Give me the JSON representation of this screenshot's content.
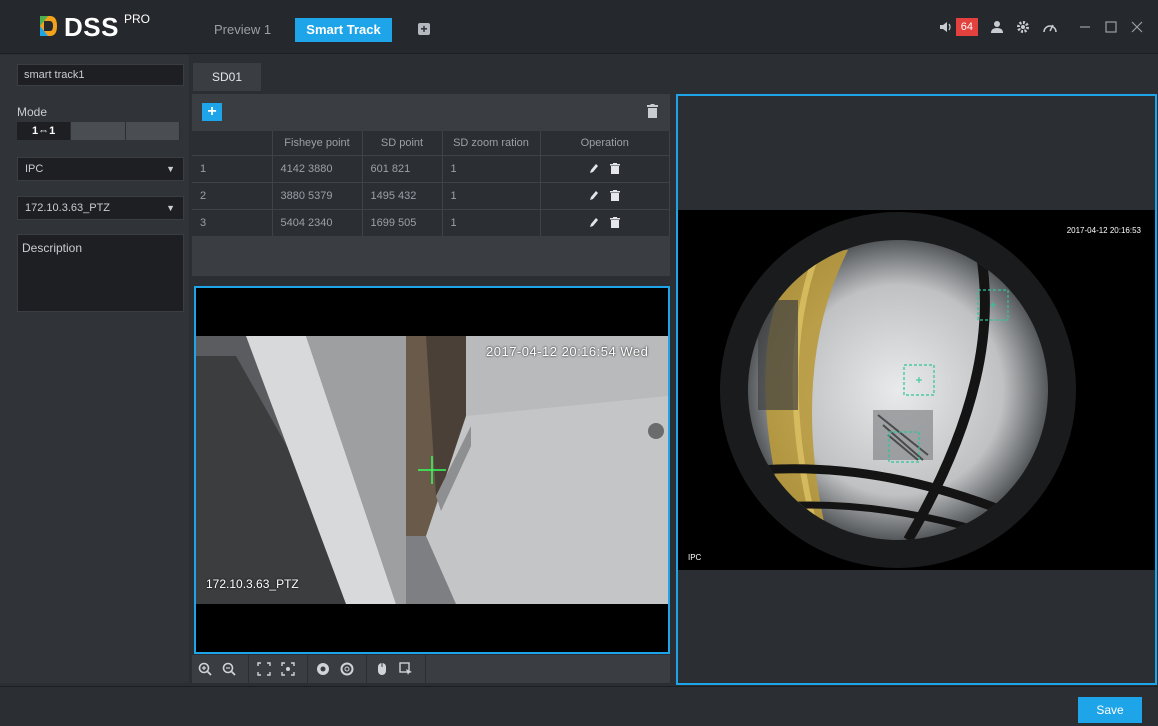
{
  "app": {
    "logo_text": "DSS",
    "logo_sup": "PRO"
  },
  "top_tabs": {
    "preview": "Preview 1",
    "smart_track": "Smart Track",
    "add": "+"
  },
  "top_right": {
    "alarm_count": "64"
  },
  "left": {
    "name_value": "smart track1",
    "mode_label": "Mode",
    "mode_options": [
      "1⇔1",
      "",
      ""
    ],
    "device_select": "IPC",
    "channel_select": "172.10.3.63_PTZ",
    "description_label": "Description"
  },
  "subtab": "SD01",
  "table": {
    "columns": [
      "",
      "Fisheye point",
      "SD point",
      "SD zoom ration",
      "Operation"
    ],
    "rows": [
      {
        "index": "1",
        "fisheye": "4142 3880",
        "sd": "601 821",
        "zoom": "1"
      },
      {
        "index": "2",
        "fisheye": "3880 5379",
        "sd": "1495 432",
        "zoom": "1"
      },
      {
        "index": "3",
        "fisheye": "5404 2340",
        "sd": "1699 505",
        "zoom": "1"
      }
    ]
  },
  "video_left": {
    "timestamp": "2017-04-12 20:16:54 Wed",
    "label": "172.10.3.63_PTZ"
  },
  "video_right": {
    "timestamp": "2017-04-12 20:16:53",
    "label": "IPC"
  },
  "bottom": {
    "save_label": "Save"
  },
  "colors": {
    "accent": "#1ea4e9",
    "alarm": "#e2413d",
    "background": "#2b2e33"
  }
}
